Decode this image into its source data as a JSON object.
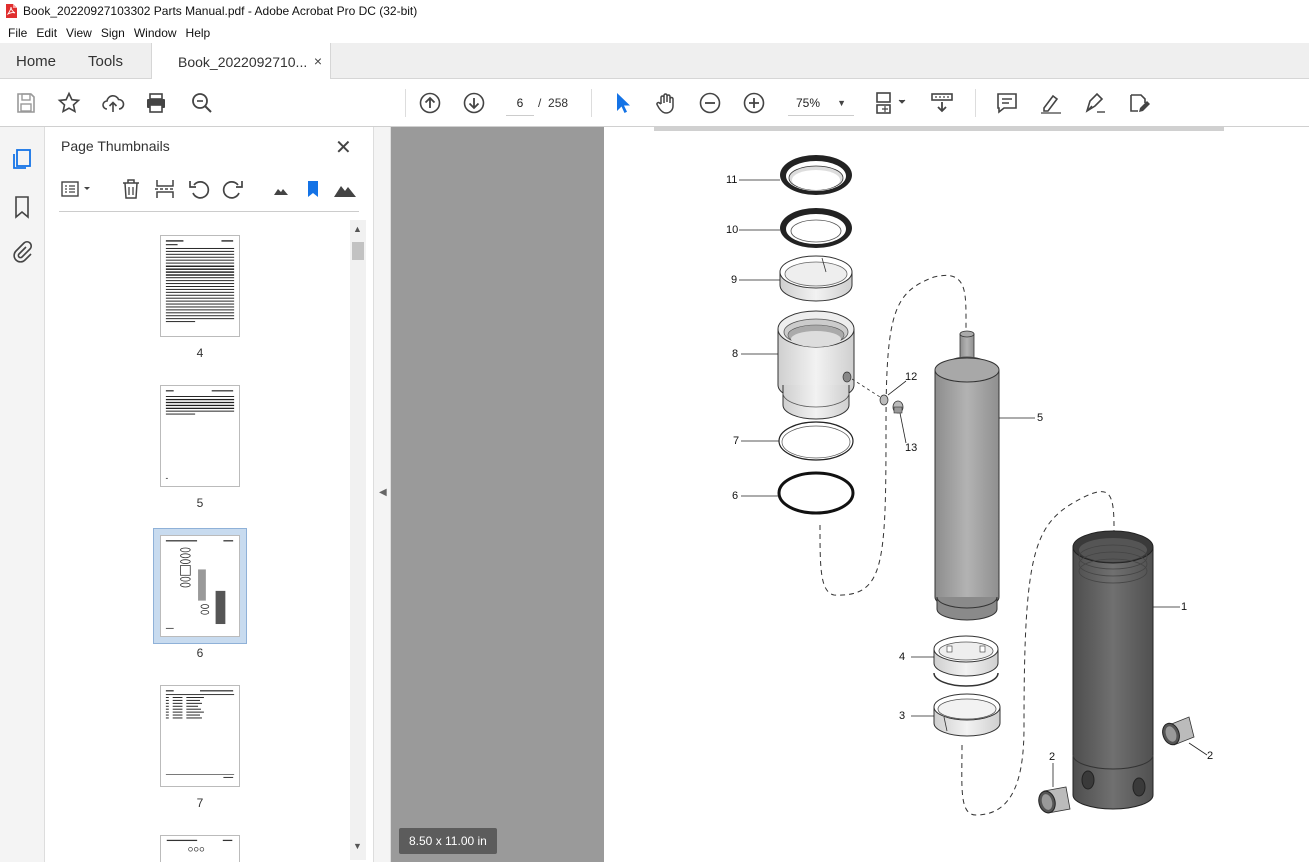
{
  "window": {
    "title": "Book_20220927103302 Parts Manual.pdf - Adobe Acrobat Pro DC (32-bit)"
  },
  "menu": {
    "items": [
      "File",
      "Edit",
      "View",
      "Sign",
      "Window",
      "Help"
    ]
  },
  "tabs": {
    "home": "Home",
    "tools": "Tools",
    "document": "Book_2022092710...",
    "close": "×"
  },
  "toolbar": {
    "current_page": "6",
    "page_separator": "/",
    "total_pages": "258",
    "zoom": "75%",
    "icons": [
      "save-icon",
      "star-icon",
      "upload-icon",
      "print-icon",
      "search-zoom-icon",
      "page-up-icon",
      "page-down-icon",
      "select-arrow-icon",
      "hand-icon",
      "zoom-out-icon",
      "zoom-in-icon",
      "fit-page-icon",
      "scroll-mode-icon",
      "comment-icon",
      "highlight-icon",
      "sign-icon",
      "edit-pdf-icon"
    ]
  },
  "panel": {
    "title": "Page Thumbnails",
    "close": "✕",
    "thumbnails": [
      {
        "page": "4"
      },
      {
        "page": "5"
      },
      {
        "page": "6",
        "selected": true
      },
      {
        "page": "7"
      }
    ]
  },
  "status": {
    "page_size": "8.50 x 11.00 in"
  },
  "diagram": {
    "callouts": [
      "11",
      "10",
      "9",
      "8",
      "12",
      "13",
      "7",
      "6",
      "5",
      "4",
      "3",
      "1",
      "2",
      "2"
    ]
  },
  "colors": {
    "accent": "#1473e6",
    "doc_background": "#9a9a9a",
    "selection": "#c8dbef"
  }
}
